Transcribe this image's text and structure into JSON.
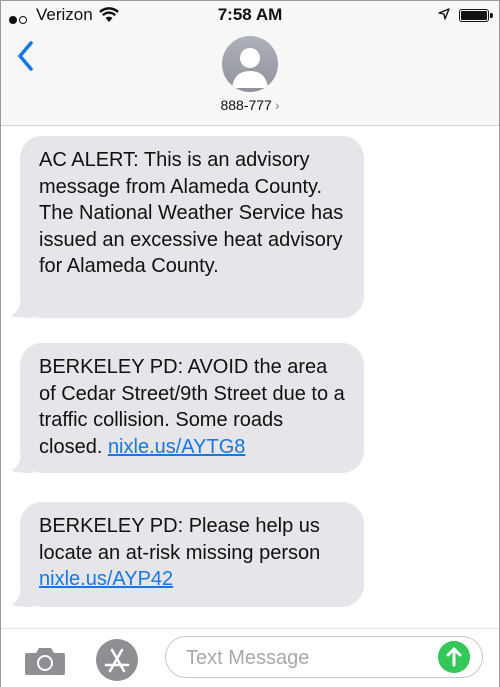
{
  "status_bar": {
    "carrier": "Verizon",
    "time": "7:58 AM"
  },
  "header": {
    "contact": "888-777",
    "contact_chevron": "›"
  },
  "messages": [
    {
      "text": "AC ALERT: This is an advisory message from Alameda County. The National Weather Service has issued an excessive heat advisory for Alameda County."
    },
    {
      "text": "BERKELEY PD: AVOID the area of Cedar Street/9th Street due to a traffic collision. Some roads closed.",
      "link": "nixle.us/AYTG8"
    },
    {
      "text": "BERKELEY PD: Please help us locate an at-risk missing person",
      "link": "nixle.us/AYP42"
    }
  ],
  "composer": {
    "placeholder": "Text Message"
  },
  "colors": {
    "accent": "#1677e6",
    "bubble": "#e5e5ea",
    "send": "#34c759"
  },
  "icons": [
    "signal-dots-icon",
    "wifi-icon",
    "location-arrow-icon",
    "battery-icon",
    "back-chevron-icon",
    "contact-avatar-icon",
    "camera-icon",
    "app-store-icon",
    "send-arrow-icon"
  ]
}
